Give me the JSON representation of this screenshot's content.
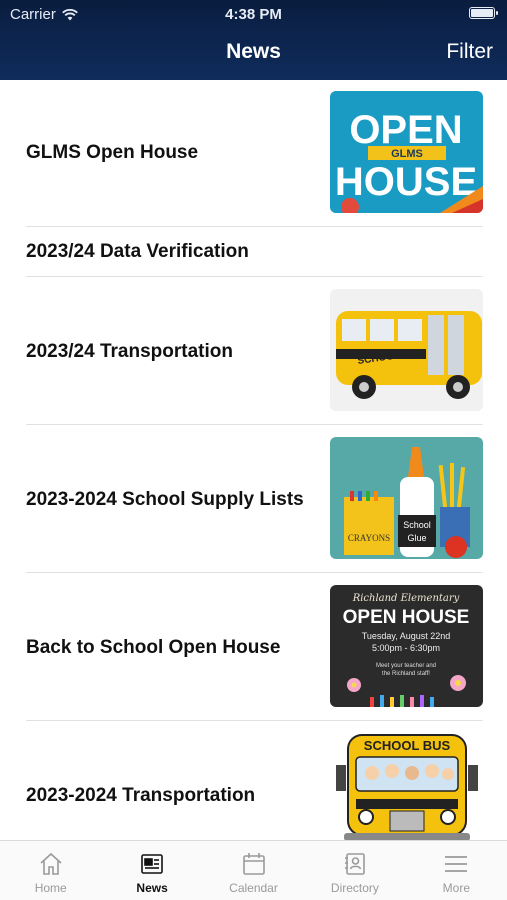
{
  "status_bar": {
    "carrier": "Carrier",
    "time": "4:38 PM"
  },
  "header": {
    "title": "News",
    "filter_label": "Filter"
  },
  "news": [
    {
      "title": "GLMS Open House",
      "image": {
        "line1": "OPEN",
        "badge": "GLMS",
        "line2": "HOUSE"
      }
    },
    {
      "title": "2023/24 Data Verification"
    },
    {
      "title": "2023/24 Transportation",
      "image": {
        "label": "SCHOOL"
      }
    },
    {
      "title": "2023-2024 School Supply Lists",
      "image": {
        "crayons": "CRAYONS",
        "glue1": "School",
        "glue2": "Glue"
      }
    },
    {
      "title": "Back to School Open House",
      "image": {
        "script": "Richland Elementary",
        "heading": "OPEN HOUSE",
        "date": "Tuesday, August 22nd",
        "time": "5:00pm - 6:30pm",
        "note1": "Meet your teacher and",
        "note2": "the Richland staff!"
      }
    },
    {
      "title": "2023-2024 Transportation",
      "image": {
        "label": "SCHOOL BUS"
      }
    }
  ],
  "tabs": [
    {
      "label": "Home",
      "icon": "home-icon"
    },
    {
      "label": "News",
      "icon": "news-icon"
    },
    {
      "label": "Calendar",
      "icon": "calendar-icon"
    },
    {
      "label": "Directory",
      "icon": "directory-icon"
    },
    {
      "label": "More",
      "icon": "menu-icon"
    }
  ],
  "colors": {
    "header": "#0f2c5c",
    "active_tab": "#111111",
    "inactive_tab": "#9a9a9a"
  }
}
